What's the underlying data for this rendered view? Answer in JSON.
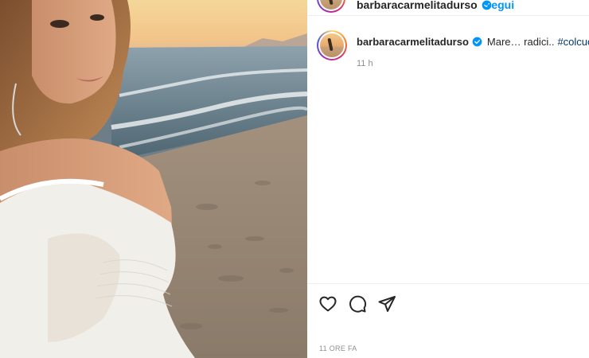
{
  "post": {
    "username": "barbaracarmelitadurso",
    "follow_label": "Segui",
    "caption": {
      "text": "Mare… radici..",
      "hashtag": "#colcuore"
    },
    "time_ago": "11 h",
    "date_label": "11 ORE FA"
  },
  "icons": {
    "like": "heart-icon",
    "comment": "comment-icon",
    "share": "share-icon",
    "verified": "verified-badge-icon"
  },
  "colors": {
    "link": "#0095f6",
    "hashtag": "#00376b",
    "muted": "#8e8e8e",
    "verified": "#0095f6"
  }
}
